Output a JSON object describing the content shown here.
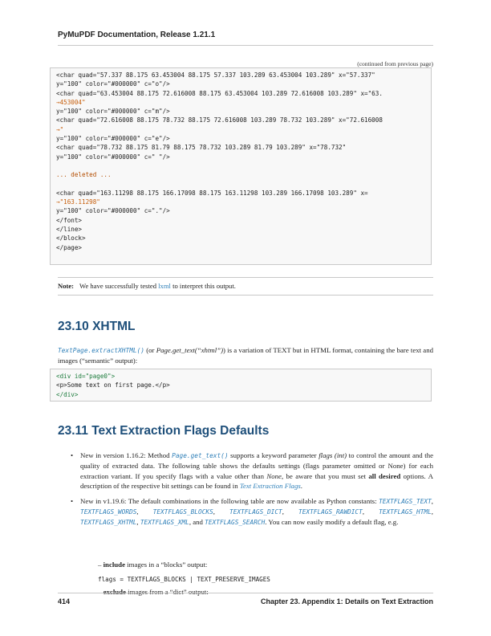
{
  "header": {
    "title": "PyMuPDF Documentation, Release 1.21.1"
  },
  "continued": "(continued from previous page)",
  "code1": [
    "<char quad=\"57.337 88.175 63.453004 88.175 57.337 103.289 63.453004 103.289\" x=\"57.337\"",
    "y=\"100\" color=\"#000000\" c=\"o\"/>",
    "<char quad=\"63.453004 88.175 72.616008 88.175 63.453004 103.289 72.616008 103.289\" x=\"63.",
    "→453004\"",
    "y=\"100\" color=\"#000000\" c=\"m\"/>",
    "<char quad=\"72.616008 88.175 78.732 88.175 72.616008 103.289 78.732 103.289\" x=\"72.616008",
    "→\"",
    "y=\"100\" color=\"#000000\" c=\"e\"/>",
    "<char quad=\"78.732 88.175 81.79 88.175 78.732 103.289 81.79 103.289\" x=\"78.732\"",
    "y=\"100\" color=\"#000000\" c=\" \"/>",
    "",
    "... deleted ...",
    "",
    "<char quad=\"163.11298 88.175 166.17098 88.175 163.11298 103.289 166.17098 103.289\" x=",
    "→\"163.11298\"",
    "y=\"100\" color=\"#000000\" c=\".\"/>",
    "</font>",
    "</line>",
    "</block>",
    "</page>"
  ],
  "note": {
    "label": "Note:",
    "pre": "We have successfully tested",
    "link": "lxml",
    "post": "to interpret this output."
  },
  "s1": {
    "heading": "23.10 XHTML",
    "p_link": "TextPage.extractXHTML()",
    "p_mid1": " (or ",
    "p_em": "Page.get_text(“xhtml”)",
    "p_rest": ") is a variation of TEXT but in HTML format, containing the bare text and images (“semantic” output):"
  },
  "code2": [
    "<div id=\"page0\">",
    "<p>Some text on first page.</p>",
    "</div>"
  ],
  "s2": {
    "heading": "23.11 Text Extraction Flags Defaults",
    "b1_a": "New in version 1.16.2: Method ",
    "b1_link": "Page.get_text()",
    "b1_b": " supports a keyword parameter ",
    "b1_em": "flags (int)",
    "b1_c": " to control the amount and the quality of extracted data. The following table shows the defaults settings (flags parameter omitted or None) for each extraction variant. If you specify flags with a value other than ",
    "b1_none": "None",
    "b1_d": ", be aware that you must set ",
    "b1_bold": "all desired",
    "b1_e": " options. A description of the respective bit settings can be found in ",
    "b1_link2": "Text Extraction Flags",
    "b1_f": ".",
    "b2_a": "New in v1.19.6: The default combinations in the following table are now available as Python constants: ",
    "b2_c1": "TEXTFLAGS_TEXT",
    "b2_c2": "TEXTFLAGS_WORDS",
    "b2_c3": "TEXTFLAGS_BLOCKS",
    "b2_c4": "TEXTFLAGS_DICT",
    "b2_c5": "TEXTFLAGS_RAWDICT",
    "b2_c6": "TEXTFLAGS_HTML",
    "b2_c7": "TEXTFLAGS_XHTML",
    "b2_c8": "TEXTFLAGS_XML",
    "b2_and": ", and ",
    "b2_c9": "TEXTFLAGS_SEARCH",
    "b2_b": ". You can now easily modify a default flag, e.g.",
    "sub1_bold": "include",
    "sub1_rest": " images in a “blocks” output:",
    "code3": "flags = TEXTFLAGS_BLOCKS | TEXT_PRESERVE_IMAGES",
    "sub2_bold": "exclude",
    "sub2_rest": " images from a “dict” output:"
  },
  "footer": {
    "page": "414",
    "chapter": "Chapter 23.  Appendix 1: Details on Text Extraction"
  }
}
